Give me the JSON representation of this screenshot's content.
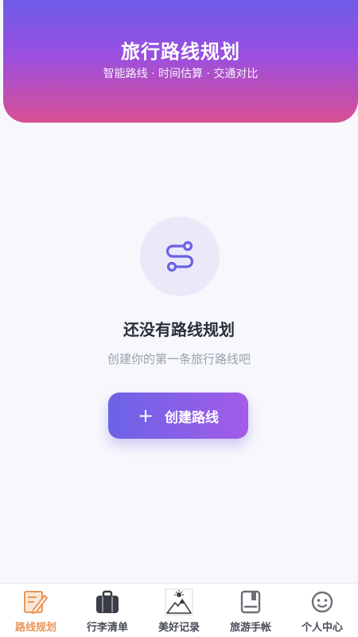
{
  "header": {
    "title": "旅行路线规划",
    "subtitle": "智能路线 · 时间估算 · 交通对比"
  },
  "empty_state": {
    "icon": "route-icon",
    "title": "还没有路线规划",
    "subtitle": "创建你的第一条旅行路线吧",
    "create_button_label": "创建路线",
    "create_button_icon": "plus-icon"
  },
  "bottom_nav": {
    "active": "路线规划",
    "active_color": "#e8965a",
    "items": [
      {
        "label": "路线规划",
        "icon": "route-plan-icon"
      },
      {
        "label": "行李清单",
        "icon": "luggage-icon"
      },
      {
        "label": "美好记录",
        "icon": "mountain-photo-icon"
      },
      {
        "label": "旅游手帐",
        "icon": "journal-icon"
      },
      {
        "label": "个人中心",
        "icon": "profile-face-icon"
      }
    ]
  },
  "colors": {
    "header_gradient_top": "#6d5ce8",
    "header_gradient_bottom": "#d94f93",
    "button_gradient_start": "#6b63e6",
    "button_gradient_end": "#a35ce8",
    "icon_accent": "#6b63e6"
  }
}
